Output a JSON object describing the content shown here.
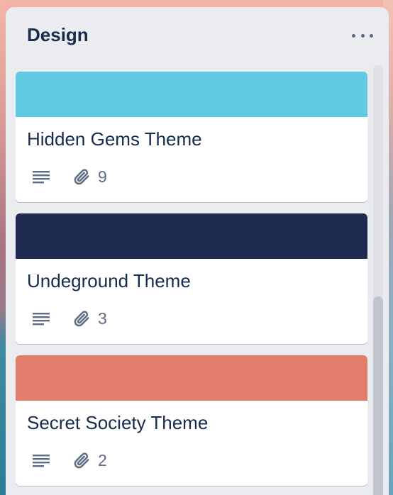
{
  "list": {
    "title": "Design",
    "menu_icon": "more-horizontal-icon"
  },
  "cards": [
    {
      "title": "Hidden Gems Theme",
      "cover_color": "#61c9e1",
      "description_icon": "description-lines-icon",
      "attachment_icon": "paperclip-icon",
      "attachment_count": "9"
    },
    {
      "title": "Undeground Theme",
      "cover_color": "#1e2a4f",
      "description_icon": "description-lines-icon",
      "attachment_icon": "paperclip-icon",
      "attachment_count": "3"
    },
    {
      "title": "Secret Society Theme",
      "cover_color": "#e27c6b",
      "description_icon": "description-lines-icon",
      "attachment_icon": "paperclip-icon",
      "attachment_count": "2"
    }
  ]
}
